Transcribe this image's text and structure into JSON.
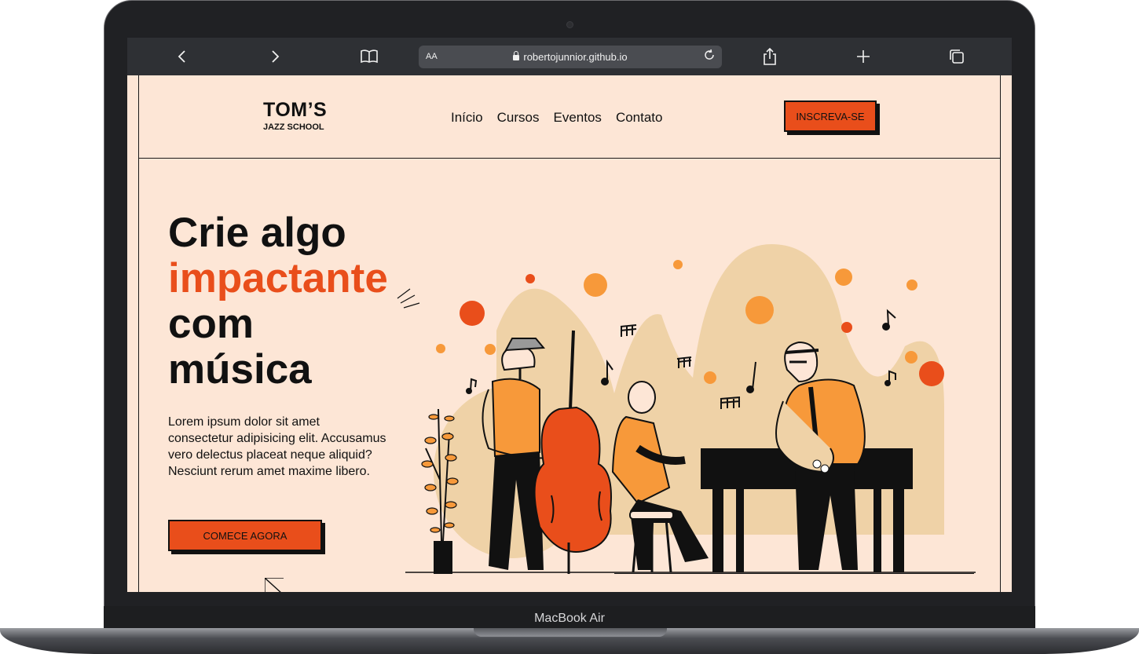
{
  "device": {
    "label": "MacBook Air"
  },
  "browser": {
    "text_size_label": "AA",
    "url": "robertojunnior.github.io",
    "icons": [
      "back-icon",
      "forward-icon",
      "bookmarks-icon",
      "lock-icon",
      "reload-icon",
      "share-icon",
      "new-tab-icon",
      "tabs-icon"
    ]
  },
  "site": {
    "logo": {
      "title": "TOM’S",
      "subtitle": "JAZZ SCHOOL"
    },
    "nav": [
      "Início",
      "Cursos",
      "Eventos",
      "Contato"
    ],
    "signup_button": "INSCREVA-SE",
    "hero": {
      "line1": "Crie algo",
      "line2": "impactante",
      "line3": "com",
      "line4": "música",
      "text": "Lorem ipsum dolor sit amet consectetur adipisicing elit. Accusamus vero delectus placeat neque aliquid? Nesciunt rerum amet maxime libero.",
      "cta": "COMECE AGORA"
    }
  },
  "colors": {
    "accent": "#e94e1b",
    "background": "#fde6d6",
    "illustration_orange": "#f7993a",
    "illustration_beige": "#efd2a7"
  }
}
